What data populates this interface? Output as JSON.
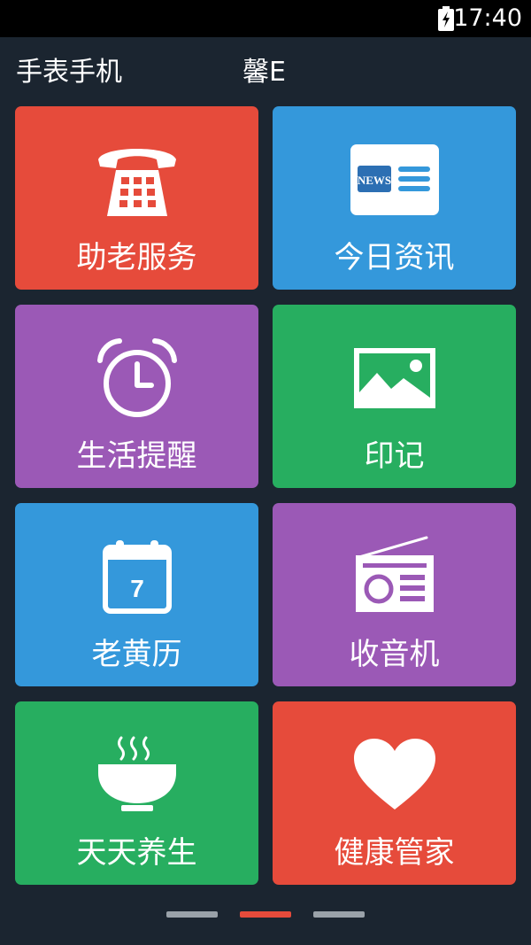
{
  "status_bar": {
    "time": "17:40",
    "battery_icon": "battery-charging-icon"
  },
  "header": {
    "left_title": "手表手机",
    "center_title": "馨E"
  },
  "tiles": [
    {
      "label": "助老服务",
      "icon": "telephone-icon",
      "color": "#e64b3b"
    },
    {
      "label": "今日资讯",
      "icon": "news-icon",
      "color": "#3498db"
    },
    {
      "label": "生活提醒",
      "icon": "alarm-clock-icon",
      "color": "#9b59b6"
    },
    {
      "label": "印记",
      "icon": "picture-icon",
      "color": "#27ae60"
    },
    {
      "label": "老黄历",
      "icon": "calendar-icon",
      "color": "#3498db",
      "icon_text": "7"
    },
    {
      "label": "收音机",
      "icon": "radio-icon",
      "color": "#9b59b6"
    },
    {
      "label": "天天养生",
      "icon": "soup-bowl-icon",
      "color": "#27ae60"
    },
    {
      "label": "健康管家",
      "icon": "heart-icon",
      "color": "#e64b3b"
    }
  ],
  "news_icon_text": "NEWS",
  "pager": {
    "pages": 3,
    "active": 1,
    "active_color": "#e64b3b",
    "inactive_color": "#9aa2a9"
  }
}
